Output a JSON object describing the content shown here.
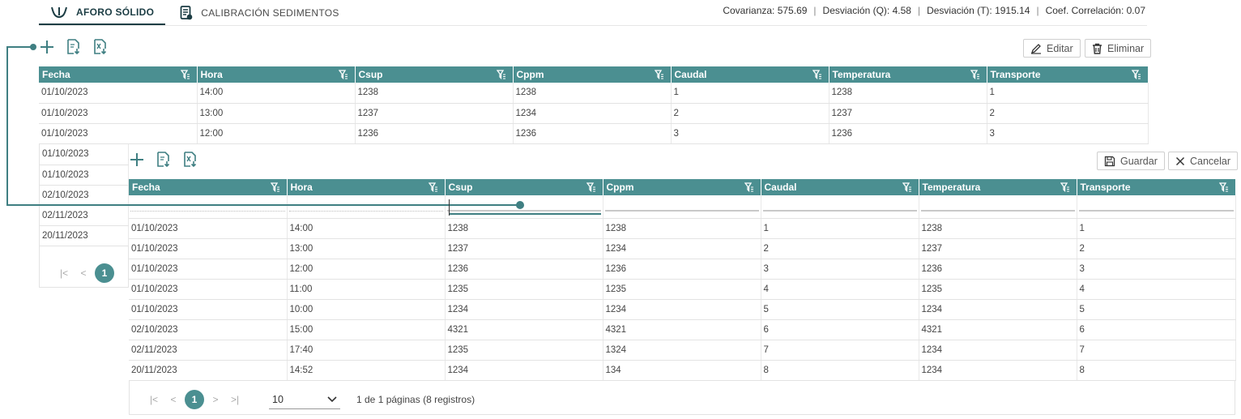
{
  "tabs": [
    {
      "label": "AFORO SÓLIDO",
      "icon": "flow-icon"
    },
    {
      "label": "CALIBRACIÓN SEDIMENTOS",
      "icon": "document-icon"
    }
  ],
  "stats": [
    "Covarianza: 575.69",
    "Desviación (Q): 4.58",
    "Desviación (T): 1915.14",
    "Coef. Correlación: 0.07"
  ],
  "toolbar_top": {
    "edit_label": "Editar",
    "delete_label": "Eliminar"
  },
  "toolbar_bottom": {
    "save_label": "Guardar",
    "cancel_label": "Cancelar"
  },
  "columns": [
    "Fecha",
    "Hora",
    "Csup",
    "Cppm",
    "Caudal",
    "Temperatura",
    "Transporte"
  ],
  "back_table": {
    "rows": [
      [
        "01/10/2023",
        "14:00",
        "1238",
        "1238",
        "1",
        "1238",
        "1"
      ],
      [
        "01/10/2023",
        "13:00",
        "1237",
        "1234",
        "2",
        "1237",
        "2"
      ],
      [
        "01/10/2023",
        "12:00",
        "1236",
        "1236",
        "3",
        "1236",
        "3"
      ]
    ],
    "partial_dates": [
      "01/10/2023",
      "01/10/2023",
      "02/10/2023",
      "02/11/2023",
      "20/11/2023"
    ],
    "pager": {
      "first": "|<",
      "prev": "<",
      "current": "1"
    }
  },
  "front_table": {
    "rows": [
      [
        "01/10/2023",
        "14:00",
        "1238",
        "1238",
        "1",
        "1238",
        "1"
      ],
      [
        "01/10/2023",
        "13:00",
        "1237",
        "1234",
        "2",
        "1237",
        "2"
      ],
      [
        "01/10/2023",
        "12:00",
        "1236",
        "1236",
        "3",
        "1236",
        "3"
      ],
      [
        "01/10/2023",
        "11:00",
        "1235",
        "1235",
        "4",
        "1235",
        "4"
      ],
      [
        "01/10/2023",
        "10:00",
        "1234",
        "1234",
        "5",
        "1234",
        "5"
      ],
      [
        "02/10/2023",
        "15:00",
        "4321",
        "4321",
        "6",
        "4321",
        "6"
      ],
      [
        "02/11/2023",
        "17:40",
        "1235",
        "1324",
        "7",
        "1234",
        "7"
      ],
      [
        "20/11/2023",
        "14:52",
        "1234",
        "134",
        "8",
        "1234",
        "8"
      ]
    ],
    "pager": {
      "first": "|<",
      "prev": "<",
      "current": "1",
      "next": ">",
      "last": ">|",
      "page_size": "10",
      "summary": "1 de 1 páginas (8 registros)"
    }
  },
  "colors": {
    "accent": "#4b8f91",
    "dark": "#1c3d44",
    "connector": "#3f7f82"
  }
}
